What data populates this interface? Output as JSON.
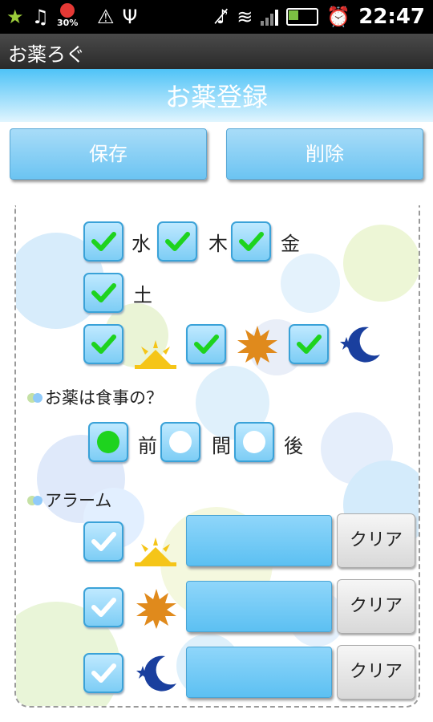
{
  "status_bar": {
    "icons": [
      "star-icon",
      "music-note-icon",
      "weather-icon",
      "warning-icon",
      "usb-icon",
      "mute-icon",
      "wifi-icon",
      "signal-icon",
      "battery-icon",
      "alarm-icon"
    ],
    "battery_percent": "30%",
    "time": "22:47"
  },
  "app": {
    "title": "お薬ろぐ"
  },
  "header": {
    "title": "お薬登録"
  },
  "toolbar": {
    "save_label": "保存",
    "delete_label": "削除"
  },
  "days": {
    "wed": "水",
    "thu": "木",
    "fri": "金",
    "sat": "土"
  },
  "meal_section": {
    "title": "お薬は食事の？",
    "options": [
      "前",
      "間",
      "後"
    ],
    "selected": "前"
  },
  "alarm_section": {
    "title": "アラーム",
    "clear_label": "クリア"
  },
  "colors": {
    "accent": "#4fc3f7",
    "check": "#1ed31e",
    "sun": "#e08a1c",
    "moon": "#1a3f9e"
  }
}
